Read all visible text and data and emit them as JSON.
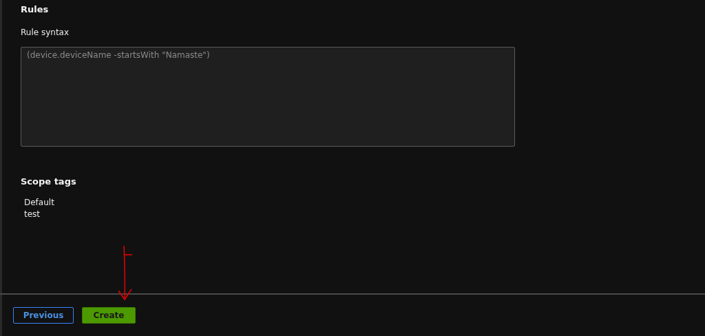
{
  "rules": {
    "title": "Rules",
    "field_label": "Rule syntax",
    "rule_syntax": {
      "value": "(device.deviceName -startsWith \"Namaste\")"
    }
  },
  "scope_tags": {
    "title": "Scope tags",
    "items": [
      "Default",
      "test"
    ]
  },
  "footer": {
    "buttons": [
      {
        "label": "Previous",
        "kind": "secondary"
      },
      {
        "label": "Create",
        "kind": "primary"
      }
    ]
  }
}
